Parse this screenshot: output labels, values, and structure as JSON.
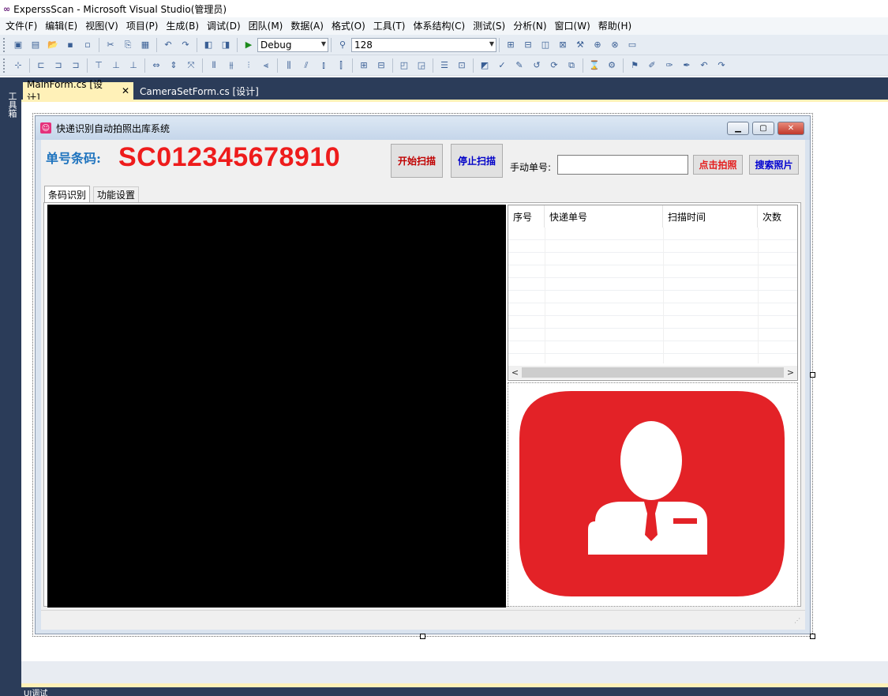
{
  "vs": {
    "window_title": "ExperssScan - Microsoft Visual Studio(管理员)",
    "menu": [
      "文件(F)",
      "编辑(E)",
      "视图(V)",
      "项目(P)",
      "生成(B)",
      "调试(D)",
      "团队(M)",
      "数据(A)",
      "格式(O)",
      "工具(T)",
      "体系结构(C)",
      "测试(S)",
      "分析(N)",
      "窗口(W)",
      "帮助(H)"
    ],
    "toolbar": {
      "config_value": "Debug",
      "find_value": "128"
    },
    "toolbox_label": "工具箱",
    "tabs": [
      {
        "label": "MainForm.cs [设计]",
        "active": true
      },
      {
        "label": "CameraSetForm.cs [设计]",
        "active": false
      }
    ],
    "bottom_panel_label": "UI调试"
  },
  "form": {
    "title": "快递识别自动拍照出库系统",
    "barcode_label": "单号条码:",
    "barcode_value": "SC012345678910",
    "buttons": {
      "start_scan": "开始扫描",
      "stop_scan": "停止扫描",
      "snap": "点击拍照",
      "search": "搜索照片"
    },
    "manual_label": "手动单号:",
    "manual_value": "",
    "inner_tabs": [
      "条码识别",
      "功能设置"
    ],
    "grid": {
      "columns": [
        "序号",
        "快递单号",
        "扫描时间",
        "次数"
      ],
      "rows": []
    },
    "colors": {
      "barcode_value": "#ee1c1c",
      "barcode_label": "#1e73be",
      "photo_placeholder": "#e32227"
    },
    "photo_placeholder_icon": "person-avatar-icon"
  }
}
